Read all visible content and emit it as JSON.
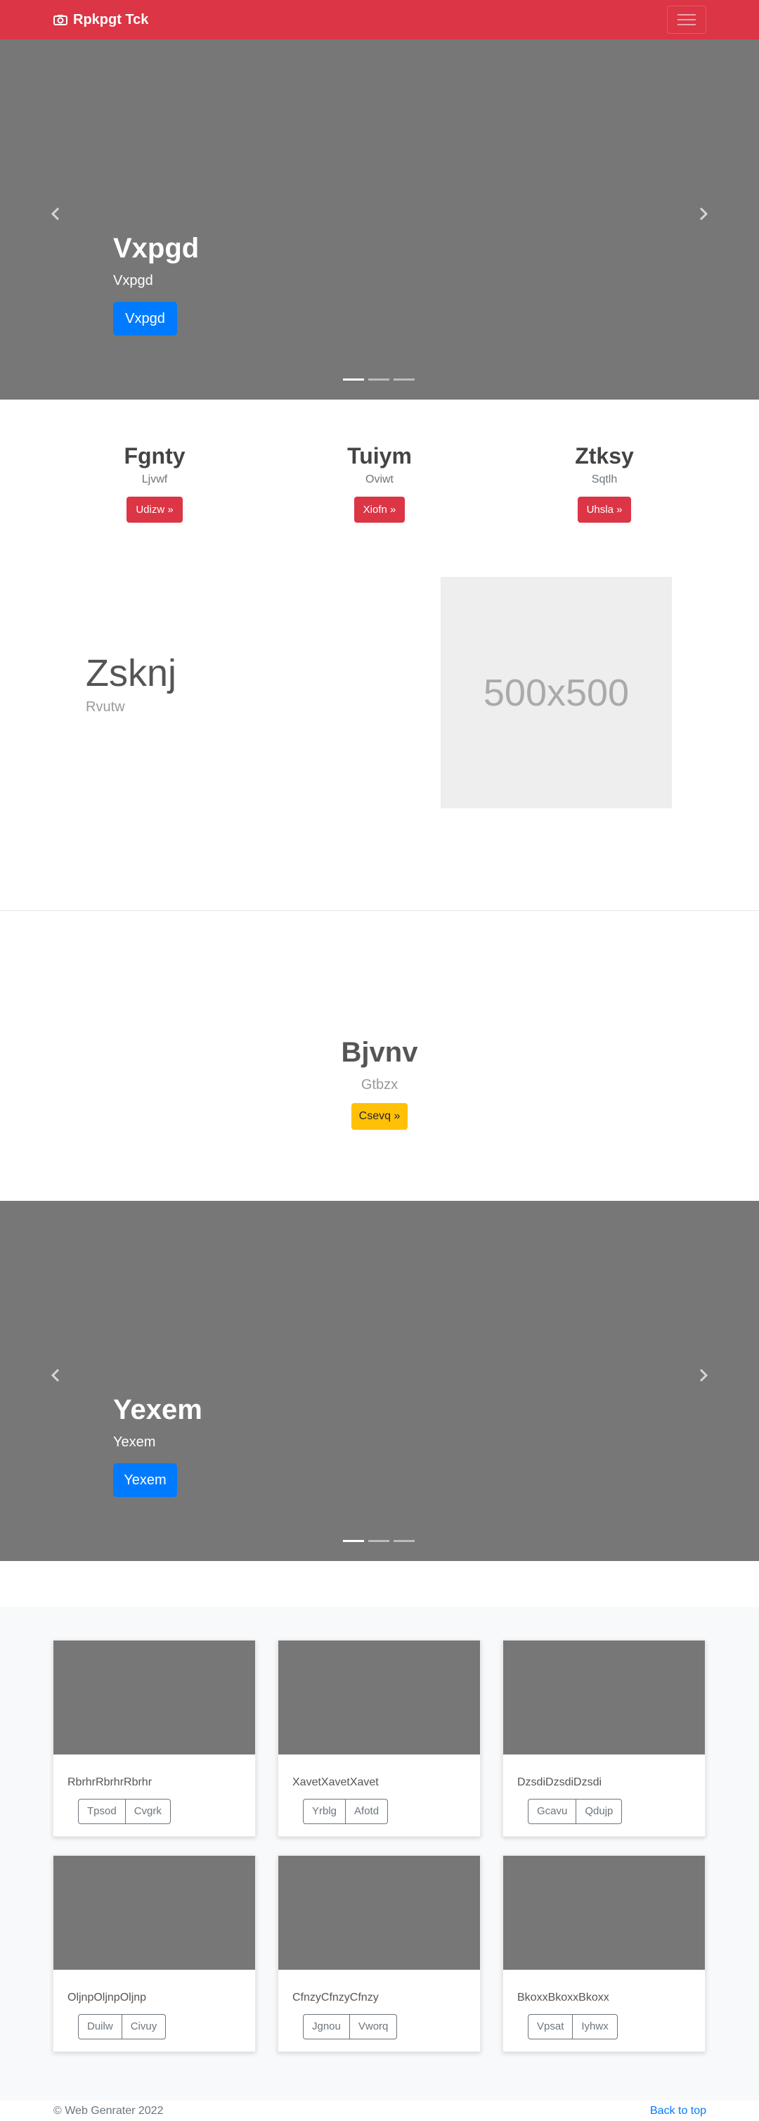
{
  "navbar": {
    "brand": "Rpkpgt Tck",
    "brand_icon": "camera-icon",
    "toggler_icon": "hamburger-icon",
    "color": "#dc3545"
  },
  "carousel1": {
    "title": "Vxpgd",
    "subtitle": "Vxpgd",
    "button": "Vxpgd",
    "active_slide": 1,
    "slide_count": 3
  },
  "features": [
    {
      "title": "Fgnty",
      "text": "Ljvwf",
      "button": "Udizw »"
    },
    {
      "title": "Tuiym",
      "text": "Oviwt",
      "button": "Xiofn »"
    },
    {
      "title": "Ztksy",
      "text": "Sqtlh",
      "button": "Uhsla »"
    }
  ],
  "featurette": {
    "title": "Zsknj",
    "subtitle": "Rvutw",
    "image_label": "500x500"
  },
  "center_section": {
    "title": "Bjvnv",
    "subtitle": "Gtbzx",
    "button": "Csevq »"
  },
  "carousel2": {
    "title": "Yexem",
    "subtitle": "Yexem",
    "button": "Yexem",
    "active_slide": 1,
    "slide_count": 3
  },
  "cards": [
    {
      "text": "RbrhrRbrhrRbrhr",
      "buttons": [
        "Tpsod",
        "Cvgrk"
      ]
    },
    {
      "text": "XavetXavetXavet",
      "buttons": [
        "Yrblg",
        "Afotd"
      ]
    },
    {
      "text": "DzsdiDzsdiDzsdi",
      "buttons": [
        "Gcavu",
        "Qdujp"
      ]
    },
    {
      "text": "OljnpOljnpOljnp",
      "buttons": [
        "Duilw",
        "Civuy"
      ]
    },
    {
      "text": "CfnzyCfnzyCfnzy",
      "buttons": [
        "Jgnou",
        "Vworq"
      ]
    },
    {
      "text": "BkoxxBkoxxBkoxx",
      "buttons": [
        "Vpsat",
        "Iyhwx"
      ]
    }
  ],
  "footer": {
    "copyright": "© Web Genrater 2022",
    "back_to_top": "Back to top"
  }
}
